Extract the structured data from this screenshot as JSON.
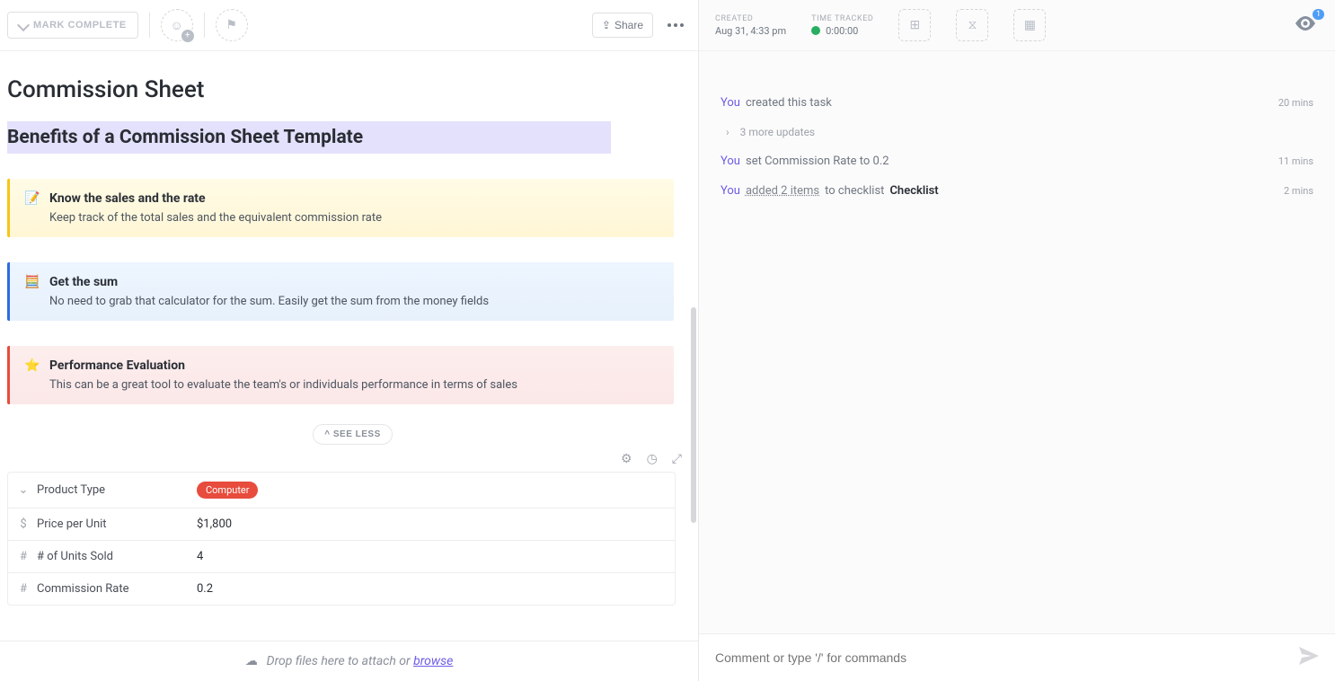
{
  "toolbar": {
    "mark_complete": "MARK COMPLETE",
    "share": "Share"
  },
  "meta": {
    "created_label": "CREATED",
    "created_value": "Aug 31, 4:33 pm",
    "time_tracked_label": "TIME TRACKED",
    "time_tracked_value": "0:00:00",
    "watchers": "1"
  },
  "task": {
    "title": "Commission Sheet",
    "benefits_heading": "Benefits of a Commission Sheet Template"
  },
  "callouts": [
    {
      "icon": "📝",
      "title": "Know the sales and the rate",
      "body": "Keep track of the total sales and the equivalent commission rate"
    },
    {
      "icon": "🧮",
      "title": "Get the sum",
      "body": "No need to grab that calculator for the sum. Easily get the sum from the money fields"
    },
    {
      "icon": "⭐",
      "title": "Performance Evaluation",
      "body": "This can be a great tool to evaluate the team's or individuals performance in terms of sales"
    }
  ],
  "see_less": "^ SEE LESS",
  "fields": [
    {
      "icon": "⌄",
      "label": "Product Type",
      "value": "Computer",
      "type": "chip"
    },
    {
      "icon": "$",
      "label": "Price per Unit",
      "value": "$1,800",
      "type": "text"
    },
    {
      "icon": "#",
      "label": "# of Units Sold",
      "value": "4",
      "type": "text"
    },
    {
      "icon": "#",
      "label": "Commission Rate",
      "value": "0.2",
      "type": "text"
    }
  ],
  "activity": [
    {
      "you": "You",
      "text": "created this task",
      "time": "20 mins",
      "type": "plain"
    },
    {
      "text": "3 more updates",
      "type": "more"
    },
    {
      "you": "You",
      "text": "set Commission Rate to 0.2",
      "time": "11 mins",
      "type": "plain"
    },
    {
      "you": "You",
      "link": "added 2 items",
      "mid": "to checklist",
      "checklist": "Checklist",
      "time": "2 mins",
      "type": "checklist"
    }
  ],
  "footer": {
    "drop_text": "Drop files here to attach or ",
    "browse": "browse",
    "comment_placeholder": "Comment or type '/' for commands"
  }
}
